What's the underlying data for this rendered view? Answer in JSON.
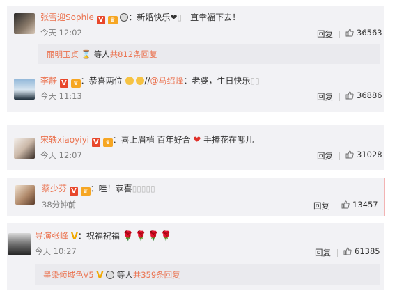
{
  "comments": [
    {
      "name": "张雪迎Sophie",
      "text_prefix": "：新婚快乐",
      "text_suffix": "一直幸福下去！",
      "time": "今天 12:02",
      "reply": "回复",
      "likes": "36563"
    },
    {
      "sub_name": "丽明玉贞",
      "sub_text": "等人",
      "sub_count": "共812条回复"
    },
    {
      "name": "李静",
      "text_prefix": "：恭喜两位",
      "text_mid": "//",
      "mention": "@马绍峰",
      "text_suffix": "：老婆，生日快乐",
      "time": "今天 11:13",
      "reply": "回复",
      "likes": "36886"
    },
    {
      "name": "宋轶xiaoyiyi",
      "text_prefix": "：喜上眉梢 百年好合",
      "text_suffix": "手捧花在哪儿",
      "time": "今天 12:07",
      "reply": "回复",
      "likes": "31028"
    },
    {
      "name": "蔡少芬",
      "text_prefix": "：哇！恭喜",
      "time": "38分钟前",
      "reply": "回复",
      "likes": "13457"
    },
    {
      "name": "导演张峰",
      "text_prefix": "：祝福祝福",
      "time": "今天 10:27",
      "reply": "回复",
      "likes": "61385"
    },
    {
      "sub_name": "墨染倾城色V5",
      "sub_text": "等人",
      "sub_count": "共359条回复"
    }
  ]
}
